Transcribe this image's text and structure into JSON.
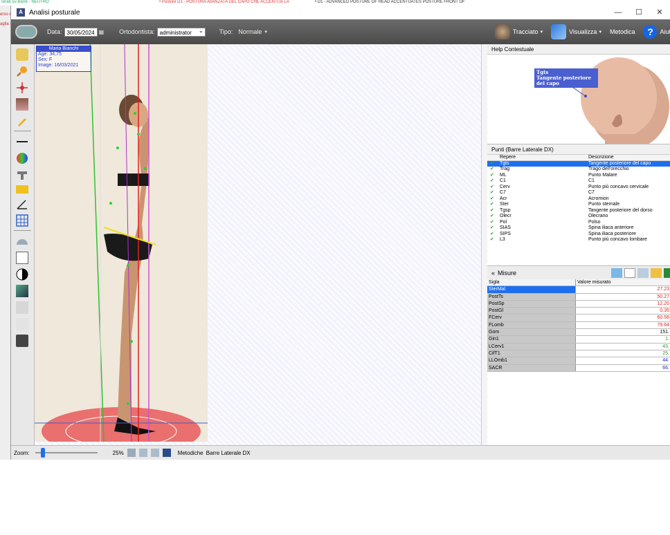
{
  "background": {
    "top_left_text": "rerati su Barré - NEUTRO",
    "top_mid_text": "• Posture D1 - POSTURA AVANZATA DEL CAPO CHE ACCENTUA LA",
    "top_right_text": "• D1 - ADVANCED POSTURE OF HEAD ACCENTUATES POSTURE FRONT OF",
    "left_text_1": "erso e",
    "left_text_2": "aglia s"
  },
  "window": {
    "title": "Analisi posturale",
    "minimize_glyph": "—",
    "maximize_glyph": "☐",
    "close_glyph": "✕"
  },
  "toolbar": {
    "date_label": "Data:",
    "date_value": "30/05/2024",
    "ortho_label": "Ortodontista:",
    "ortho_value": "administrator",
    "tipo_label": "Tipo:",
    "tipo_value": "Normale",
    "tracciato_label": "Tracciato",
    "visualizza_label": "Visualizza",
    "metodica_label": "Metodica",
    "aiuto_label": "Aiut",
    "help_glyph": "?",
    "dropdown_glyph": "▾"
  },
  "patient": {
    "name": "Maria Bianchi",
    "age": "Age: 34,75",
    "sex": "Sex: F",
    "image_date": "Image: 16/03/2021"
  },
  "help_panel": {
    "title": "Help Contestuale",
    "callout_line1": "Tgts",
    "callout_line2": "Tangente posteriore del capo"
  },
  "points_panel": {
    "title": "Punti  (Barre Laterale DX)",
    "col1": "Repere",
    "col2": "Descrizione",
    "rows": [
      {
        "code": "Tgts",
        "desc": "Tangente posteriore del capo"
      },
      {
        "code": "Trag",
        "desc": "Trago dell'orecchio"
      },
      {
        "code": "ML",
        "desc": "Punto Malare"
      },
      {
        "code": "C1",
        "desc": "C1"
      },
      {
        "code": "Cerv",
        "desc": "Punto più concavo cervicale"
      },
      {
        "code": "C7",
        "desc": "C7"
      },
      {
        "code": "Acr",
        "desc": "Acromion"
      },
      {
        "code": "Ster",
        "desc": "Punto sternale"
      },
      {
        "code": "Tgsp",
        "desc": "Tangente posteriore del dorso"
      },
      {
        "code": "Olecr",
        "desc": "Olecrano"
      },
      {
        "code": "Pol",
        "desc": "Polso"
      },
      {
        "code": "SIAS",
        "desc": "Spina iliaca anteriore"
      },
      {
        "code": "SIPS",
        "desc": "Spina iliaca posteriore"
      },
      {
        "code": "L3",
        "desc": "Punto più concavo lombare"
      }
    ]
  },
  "measures": {
    "title": "Misure",
    "collapse_glyph": "«",
    "col1": "Sigla",
    "col2": "Valore misurato",
    "rows": [
      {
        "code": "SterMal",
        "value": "27.23",
        "color": "#e02020"
      },
      {
        "code": "PostTs",
        "value": "50.27",
        "color": "#e02020"
      },
      {
        "code": "PostSp",
        "value": "12.20",
        "color": "#e02020"
      },
      {
        "code": "PostGl",
        "value": "0.35",
        "color": "#e02020"
      },
      {
        "code": "FCerv",
        "value": "60.58",
        "color": "#e02020"
      },
      {
        "code": "FLomb",
        "value": "79.64",
        "color": "#e02020"
      },
      {
        "code": "Gom",
        "value": "151.",
        "color": "#000000"
      },
      {
        "code": "Gin1",
        "value": "1.",
        "color": "#2a9a2a"
      },
      {
        "code": "LCerv1",
        "value": "43.",
        "color": "#2a9a2a"
      },
      {
        "code": "CifT1",
        "value": "25.",
        "color": "#2a9a2a"
      },
      {
        "code": "LLOmb1",
        "value": "44.",
        "color": "#2020d0"
      },
      {
        "code": "SACR",
        "value": "66.",
        "color": "#2020d0"
      }
    ]
  },
  "statusbar": {
    "zoom_label": "Zoom:",
    "zoom_value": "25%",
    "method_label": "Metodiche",
    "method_value": "Barre Laterale DX"
  }
}
